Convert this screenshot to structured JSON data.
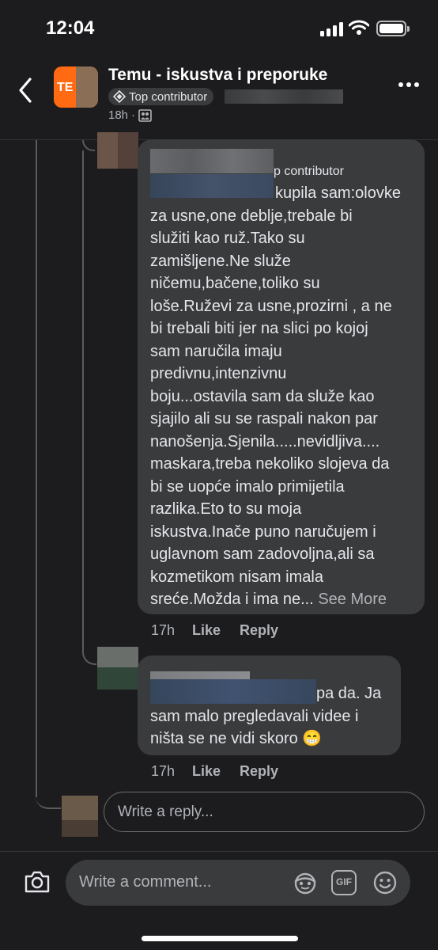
{
  "status_bar": {
    "time": "12:04"
  },
  "header": {
    "group_title": "Temu - iskustva i preporuke",
    "badge": "Top contributor",
    "time": "18h",
    "logo_text": "TE"
  },
  "comments": [
    {
      "badge_fragment": "p contributor",
      "text": "kupila sam:olovke\nza usne,one deblje,trebale bi\nslužiti kao ruž.Tako su\nzamišljene.Ne služe\nničemu,bačene,toliko su\nloše.Ruževi za usne,prozirni , a ne\nbi trebali biti jer na slici po kojoj\nsam naručila imaju\npredivnu,intenzivnu\nboju...ostavila sam da služe kao\nsjajilo ali su se raspali nakon par\nnanošenja.Sjenila.....nevidljiva....\nmaskara,treba nekoliko slojeva da\nbi se uopće imalo primijetila\nrazlika.Eto to su moja\niskustva.Inače puno naručujem i\nuglavnom sam zadovoljna,ali sa\nkozmetikom nisam imala\nsreće.Možda i ima ne...",
      "see_more": "See More",
      "time": "17h",
      "like": "Like",
      "reply": "Reply"
    },
    {
      "text": "pa da. Ja\nsam malo pregledavali videe i\nništa se ne vidi skoro 😁",
      "time": "17h",
      "like": "Like",
      "reply": "Reply"
    }
  ],
  "reply_box": {
    "placeholder": "Write a reply..."
  },
  "comment_bar": {
    "placeholder": "Write a comment...",
    "gif_label": "GIF"
  }
}
